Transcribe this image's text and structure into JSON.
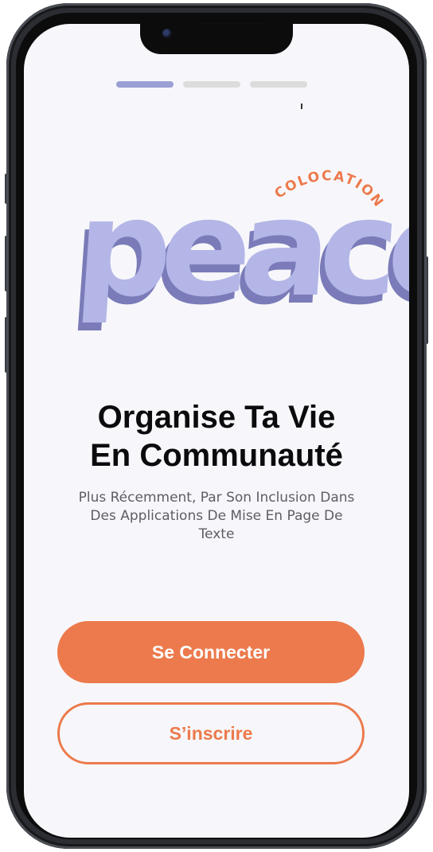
{
  "colors": {
    "accent": "#ec7a4c",
    "logo_fill": "#b3b6e6",
    "logo_shadow": "#7a7bb8",
    "progress_active": "#9b9fd4",
    "progress_inactive": "#dcdcdc"
  },
  "progress": {
    "total": 3,
    "current": 1
  },
  "logo": {
    "word": "peace",
    "tagline": "COLOCATION"
  },
  "onboarding": {
    "title_line1": "Organise Ta Vie",
    "title_line2": "En Communauté",
    "subtitle": "Plus Récemment, Par Son Inclusion Dans Des Applications De Mise En Page De Texte"
  },
  "actions": {
    "login_label": "Se Connecter",
    "signup_label": "S’inscrire"
  }
}
